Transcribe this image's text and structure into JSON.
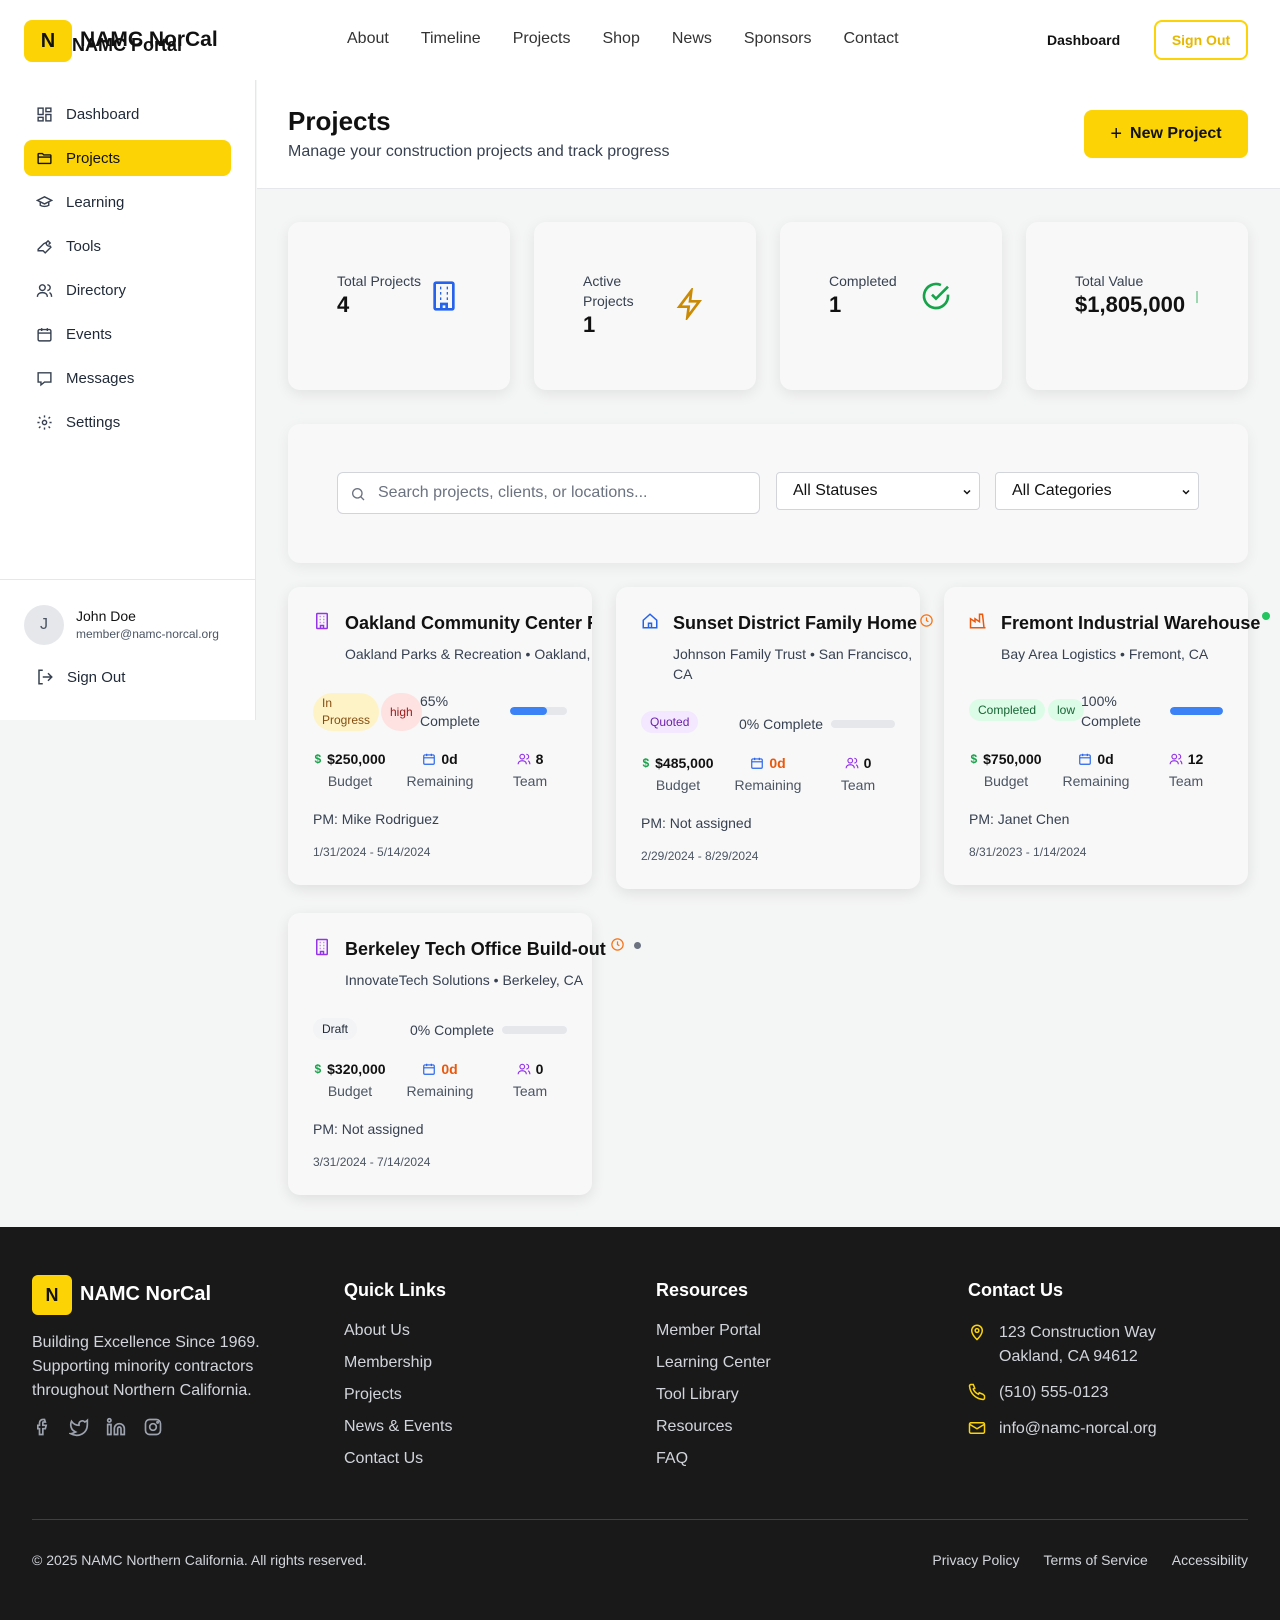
{
  "brand": {
    "logo_letter": "N",
    "name": "NAMC NorCal",
    "overlay_name": "NAMC Portal"
  },
  "topnav": {
    "links": [
      "About",
      "Timeline",
      "Projects",
      "Shop",
      "News",
      "Sponsors",
      "Contact"
    ],
    "dashboard": "Dashboard",
    "sign_out": "Sign Out"
  },
  "sidebar": {
    "items": [
      {
        "label": "Dashboard",
        "icon": "dashboard-icon"
      },
      {
        "label": "Projects",
        "icon": "folder-icon",
        "active": true
      },
      {
        "label": "Learning",
        "icon": "graduation-cap-icon"
      },
      {
        "label": "Tools",
        "icon": "wrench-icon"
      },
      {
        "label": "Directory",
        "icon": "users-icon"
      },
      {
        "label": "Events",
        "icon": "calendar-icon"
      },
      {
        "label": "Messages",
        "icon": "message-icon"
      },
      {
        "label": "Settings",
        "icon": "gear-icon"
      }
    ],
    "user": {
      "initial": "J",
      "name": "John Doe",
      "email": "member@namc-norcal.org"
    },
    "sign_out": "Sign Out"
  },
  "header": {
    "title": "Projects",
    "subtitle": "Manage your construction projects and track progress",
    "new_button": "New Project"
  },
  "stats": [
    {
      "label": "Total Projects",
      "value": "4",
      "icon": "building-icon",
      "color": "#2563eb"
    },
    {
      "label": "Active Projects",
      "value": "1",
      "icon": "lightning-icon",
      "color": "#ca8a04"
    },
    {
      "label": "Completed",
      "value": "1",
      "icon": "check-circle-icon",
      "color": "#16a34a"
    },
    {
      "label": "Total Value",
      "value": "$1,805,000",
      "icon": "dollar-icon",
      "color": "#16a34a"
    }
  ],
  "filters": {
    "search_placeholder": "Search projects, clients, or locations...",
    "status": "All Statuses",
    "category": "All Categories"
  },
  "projects": [
    {
      "title": "Oakland Community Center Renovation",
      "client": "Oakland Parks & Recreation • Oakland, CA",
      "status": "In Progress",
      "priority": "high",
      "progress_label": "65% Complete",
      "progress": 65,
      "budget": "$250,000",
      "budget_label": "Budget",
      "remaining": "0d",
      "remaining_label": "Remaining",
      "team": "8",
      "team_label": "Team",
      "pm": "PM: Mike Rodriguez",
      "dates": "1/31/2024 - 5/14/2024",
      "icon": "building-icon",
      "icon_color": "#9333ea"
    },
    {
      "title": "Sunset District Family Home",
      "client": "Johnson Family Trust • San Francisco, CA",
      "status": "Quoted",
      "priority": "",
      "progress_label": "0% Complete",
      "progress": 0,
      "budget": "$485,000",
      "budget_label": "Budget",
      "remaining": "0d",
      "remaining_label": "Remaining",
      "team": "0",
      "team_label": "Team",
      "pm": "PM: Not assigned",
      "dates": "2/29/2024 - 8/29/2024",
      "icon": "home-icon",
      "icon_color": "#2563eb"
    },
    {
      "title": "Fremont Industrial Warehouse",
      "client": "Bay Area Logistics • Fremont, CA",
      "status": "Completed",
      "priority": "low",
      "progress_label": "100% Complete",
      "progress": 100,
      "budget": "$750,000",
      "budget_label": "Budget",
      "remaining": "0d",
      "remaining_label": "Remaining",
      "team": "12",
      "team_label": "Team",
      "pm": "PM: Janet Chen",
      "dates": "8/31/2023 - 1/14/2024",
      "icon": "factory-icon",
      "icon_color": "#ea580c"
    },
    {
      "title": "Berkeley Tech Office Build-out",
      "client": "InnovateTech Solutions • Berkeley, CA",
      "status": "Draft",
      "priority": "",
      "progress_label": "0% Complete",
      "progress": 0,
      "budget": "$320,000",
      "budget_label": "Budget",
      "remaining": "0d",
      "remaining_label": "Remaining",
      "team": "0",
      "team_label": "Team",
      "pm": "PM: Not assigned",
      "dates": "3/31/2024 - 7/14/2024",
      "icon": "building-icon",
      "icon_color": "#9333ea"
    }
  ],
  "footer": {
    "logo_letter": "N",
    "name": "NAMC NorCal",
    "tagline": "Building Excellence Since 1969. Supporting minority contractors throughout Northern California.",
    "quick_links_title": "Quick Links",
    "quick_links": [
      "About Us",
      "Membership",
      "Projects",
      "News & Events",
      "Contact Us"
    ],
    "resources_title": "Resources",
    "resources": [
      "Member Portal",
      "Learning Center",
      "Tool Library",
      "Resources",
      "FAQ"
    ],
    "contact_title": "Contact Us",
    "address_line1": "123 Construction Way",
    "address_line2": "Oakland, CA 94612",
    "phone": "(510) 555-0123",
    "email": "info@namc-norcal.org",
    "copyright": "© 2025 NAMC Northern California. All rights reserved.",
    "legal": [
      "Privacy Policy",
      "Terms of Service",
      "Accessibility"
    ]
  },
  "colors": {
    "accent": "#fcd406",
    "progress": "#3b82f6",
    "footer_bg": "#19191a"
  }
}
